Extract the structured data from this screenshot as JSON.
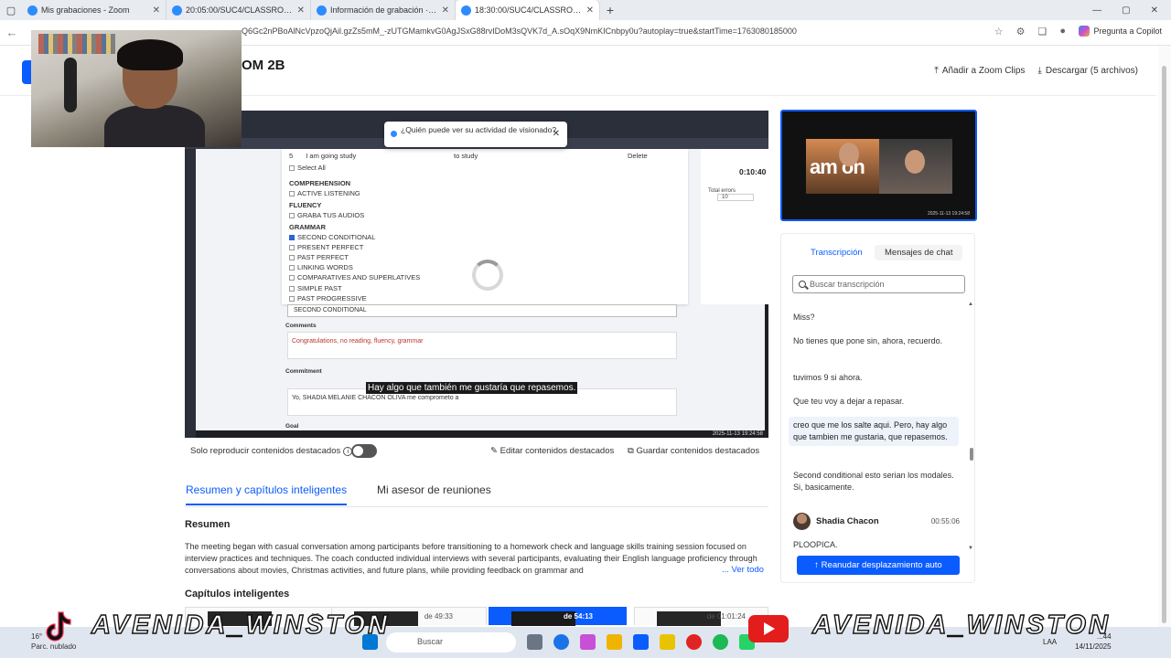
{
  "browser": {
    "tabs": [
      {
        "title": "Mis grabaciones - Zoom",
        "active": false
      },
      {
        "title": "20:05:00/SUC4/CLASSROOM",
        "active": false
      },
      {
        "title": "Información de grabación · Zoom",
        "active": false
      },
      {
        "title": "18:30:00/SUC4/CLASSROOM",
        "active": true
      }
    ],
    "new_tab": "+",
    "url": "Q6Gc2nPBoAlNcVpzoQjAil.gzZs5mM_-zUTGMamkvG0AgJSxG88rvIDoM3sQVK7d_A.sOqX9NmKICnbpy0u?autoplay=true&startTime=1763080185000",
    "copilot_label": "Pregunta a Copilot"
  },
  "page": {
    "title": "OM 2B",
    "add_clips": "Añadir a Zoom Clips",
    "download": "Descargar (5 archivos)"
  },
  "player": {
    "privacy_popup": "¿Quién puede ver su actividad de visionado?",
    "list_row_top": {
      "num": "5",
      "wrong": "I am going study",
      "right": "to study",
      "action": "Delete"
    },
    "select_all": "Select All",
    "sections": [
      {
        "header": "COMPREHENSION",
        "items": [
          {
            "label": "ACTIVE LISTENING",
            "checked": false
          }
        ]
      },
      {
        "header": "FLUENCY",
        "items": [
          {
            "label": "GRABA TUS AUDIOS",
            "checked": false
          }
        ]
      },
      {
        "header": "GRAMMAR",
        "items": [
          {
            "label": "SECOND CONDITIONAL",
            "checked": true
          },
          {
            "label": "PRESENT PERFECT",
            "checked": false
          },
          {
            "label": "PAST PERFECT",
            "checked": false
          },
          {
            "label": "LINKING WORDS",
            "checked": false
          },
          {
            "label": "COMPARATIVES AND SUPERLATIVES",
            "checked": false
          },
          {
            "label": "SIMPLE PAST",
            "checked": false
          },
          {
            "label": "PAST PROGRESSIVE",
            "checked": false
          }
        ]
      }
    ],
    "selected_tag": "SECOND CONDITIONAL",
    "timer": "0:10:40",
    "total_errors_label": "Total errors",
    "total_errors_value": "10",
    "comments_label": "Comments",
    "comments_text": "Congratulations, no reading, fluency, grammar",
    "commitment_label": "Commitment",
    "commitment_text": "Yo, SHADIA MELANIE CHACON OLIVA me comprometo a",
    "goal_label": "Goal",
    "caption": "Hay algo que también me gustaría que repasemos.",
    "stamp": "2025-11-13 19:24:58"
  },
  "highlights": {
    "only_highlights": "Solo reproducir contenidos destacados",
    "edit": "Editar contenidos destacados",
    "save": "Guardar contenidos destacados"
  },
  "subtabs": [
    "Resumen y capítulos inteligentes",
    "Mi asesor de reuniones"
  ],
  "summary": {
    "title": "Resumen",
    "text": "The meeting began with casual conversation among participants before transitioning to a homework check and language skills training session focused on interview practices and techniques. The coach conducted individual interviews with several participants, evaluating their English language proficiency through conversations about movies, Christmas activities, and future plans, while providing feedback on grammar and",
    "see_all": "... Ver todo"
  },
  "chapters": {
    "title": "Capítulos inteligentes",
    "items": [
      {
        "duration": "07"
      },
      {
        "duration": "de 49:33"
      },
      {
        "duration": "de 54:13",
        "selected": true
      },
      {
        "duration": "de 01:01:24"
      }
    ]
  },
  "gallery": {
    "overlay_text": "am on",
    "stamp": "2025-11-13 19:24:58"
  },
  "transcript_panel": {
    "tabs": [
      "Transcripción",
      "Mensajes de chat"
    ],
    "search_placeholder": "Buscar transcripción",
    "messages": [
      {
        "text": "Miss?",
        "highlighted": false
      },
      {
        "text": "No tienes que pone sin, ahora, recuerdo.",
        "highlighted": false
      },
      {
        "text": "tuvimos 9 si ahora.",
        "highlighted": false
      },
      {
        "text": "Que teu voy a dejar a repasar.",
        "highlighted": false
      },
      {
        "text": "creo que me los salte aqui. Pero, hay algo que tambien me gustaria, que repasemos.",
        "highlighted": true
      },
      {
        "text": "Second conditional esto serian los modales. Si, basicamente.",
        "highlighted": false
      }
    ],
    "speaker": {
      "name": "Shadia Chacon",
      "time": "00:55:06"
    },
    "last_message": "PLOOPICA.",
    "resume_button": "Reanudar desplazamiento auto"
  },
  "watermark": {
    "left": "AVENIDA_WINSTON",
    "right": "AVENIDA_WINSTON"
  },
  "taskbar": {
    "weather_temp": "16°",
    "weather_desc": "Parc. nublado",
    "search_placeholder": "Buscar",
    "lang": "LAA",
    "time": "...44",
    "date": "14/11/2025"
  },
  "colors": {
    "accent": "#0b5cff",
    "highlight_bg": "#edf2fb"
  }
}
